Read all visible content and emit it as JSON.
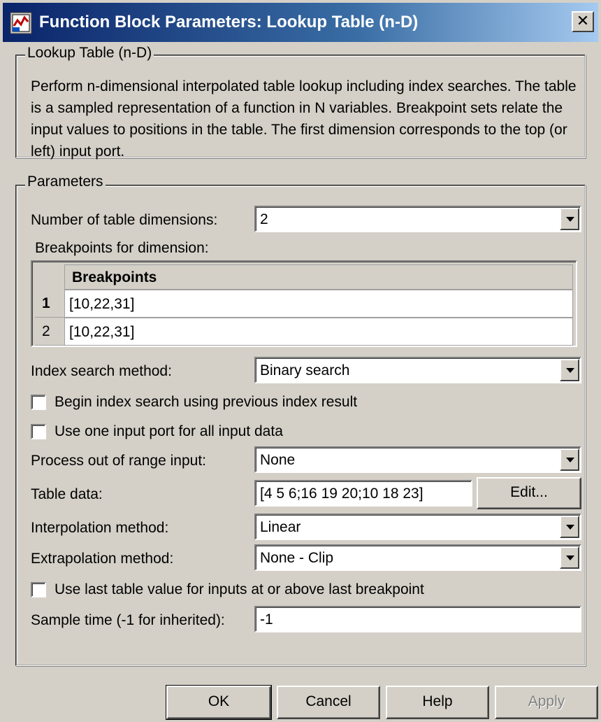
{
  "window": {
    "title": "Function Block Parameters: Lookup Table (n-D)",
    "close_glyph": "✕"
  },
  "block_group": {
    "legend": "Lookup Table (n-D)",
    "description": "Perform n-dimensional interpolated table lookup including index searches. The table is a sampled representation of a function in N variables. Breakpoint sets relate the input values to positions in the table. The first dimension corresponds to the top (or left) input port."
  },
  "parameters": {
    "legend": "Parameters",
    "num_dims": {
      "label": "Number of table dimensions:",
      "value": "2"
    },
    "breakpoints": {
      "label": "Breakpoints for dimension:",
      "column_header": "Breakpoints",
      "rows": [
        {
          "index": "1",
          "value": "[10,22,31]"
        },
        {
          "index": "2",
          "value": "[10,22,31]"
        }
      ]
    },
    "index_search": {
      "label": "Index search method:",
      "value": "Binary search"
    },
    "begin_index_search": {
      "label": "Begin index search using previous index result",
      "checked": false
    },
    "one_input_port": {
      "label": "Use one input port for all input data",
      "checked": false
    },
    "out_of_range": {
      "label": "Process out of range input:",
      "value": "None"
    },
    "table_data": {
      "label": "Table data:",
      "value": "[4 5 6;16 19 20;10 18 23]",
      "edit_label": "Edit..."
    },
    "interpolation": {
      "label": "Interpolation method:",
      "value": "Linear"
    },
    "extrapolation": {
      "label": "Extrapolation method:",
      "value": "None - Clip"
    },
    "use_last_table_value": {
      "label": "Use last table value for inputs at or above last breakpoint",
      "checked": false
    },
    "sample_time": {
      "label": "Sample time (-1 for inherited):",
      "value": "-1"
    }
  },
  "buttons": {
    "ok": "OK",
    "cancel": "Cancel",
    "help": "Help",
    "apply": "Apply"
  },
  "icons": {
    "app": "simulink-block-icon",
    "close": "close-icon",
    "dropdown": "chevron-down-icon"
  },
  "colors": {
    "title_bar_start": "#0a246a",
    "title_bar_end": "#a6caf0",
    "dialog_bg": "#d4d0c8"
  }
}
